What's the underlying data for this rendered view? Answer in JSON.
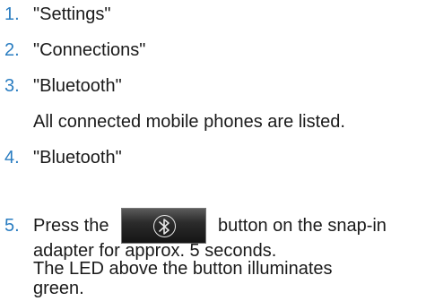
{
  "steps": [
    {
      "number": "1.",
      "text": "\"Settings\""
    },
    {
      "number": "2.",
      "text": "\"Connections\""
    },
    {
      "number": "3.",
      "text": "\"Bluetooth\"",
      "note": "All connected mobile phones are listed."
    },
    {
      "number": "4.",
      "text": "\"Bluetooth\""
    },
    {
      "number": "5.",
      "text_before": "Press the",
      "icon": "bluetooth-button-icon",
      "text_after": "button on the snap-in",
      "text_line2": "adapter for approx. 5 seconds.",
      "note_line1": "The LED above the button illuminates",
      "note_line2": "green."
    }
  ],
  "colors": {
    "number": "#2a7dc1",
    "text": "#1a1a1a"
  }
}
